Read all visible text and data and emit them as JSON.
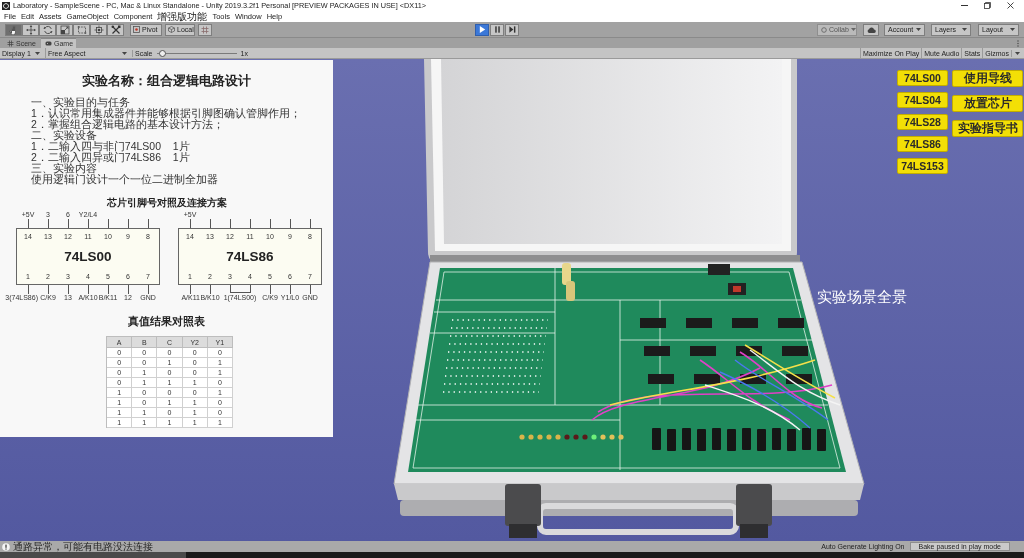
{
  "window": {
    "title": "Laboratory - SampleScene - PC, Mac & Linux Standalone - Unity 2019.3.2f1 Personal [PREVIEW PACKAGES IN USE] <DX11>"
  },
  "menu": [
    "File",
    "Edit",
    "Assets",
    "GameObject",
    "Component",
    "增强版功能",
    "Tools",
    "Window",
    "Help"
  ],
  "toolbar": {
    "tools": [
      {
        "kind": "hand",
        "selected": true
      },
      {
        "kind": "move",
        "selected": false
      },
      {
        "kind": "rotate",
        "selected": false
      },
      {
        "kind": "scale",
        "selected": false
      },
      {
        "kind": "rect",
        "selected": false
      },
      {
        "kind": "transform",
        "selected": false
      },
      {
        "kind": "custom",
        "selected": false
      }
    ],
    "pivot": "Pivot",
    "space": "Local",
    "play_controls": [
      {
        "kind": "play",
        "selected": true
      },
      {
        "kind": "pause",
        "selected": false
      },
      {
        "kind": "step",
        "selected": false
      }
    ],
    "collab": {
      "label": "Collab",
      "disabled": true
    },
    "account": "Account",
    "layers": "Layers",
    "layout": "Layout"
  },
  "tabs": [
    {
      "label": "Scene",
      "kind": "scene",
      "selected": false
    },
    {
      "label": "Game",
      "kind": "game",
      "selected": true
    }
  ],
  "game_toolbar": {
    "display": "Display 1",
    "aspect": "Free Aspect",
    "scale_label": "Scale",
    "scale_slider": {
      "level": 0.03
    },
    "scale_value": "1x",
    "toggles": [
      "Maximize On Play",
      "Mute Audio",
      "Stats"
    ],
    "gizmos": "Gizmos"
  },
  "guide_panel": {
    "title": "实验名称：组合逻辑电路设计",
    "lines": [
      "一、实验目的与任务",
      "1．认识常用集成器件并能够根据引脚图确认管脚作用；",
      "2．掌握组合逻辑电路的基本设计方法；",
      "二、实验设备",
      "1．二输入四与非门74LS00    1片",
      "2．二输入四异或门74LS86    1片",
      "三、实验内容",
      "使用逻辑门设计一个一位二进制全加器"
    ],
    "chips_heading": "芯片引脚号对照及连接方案",
    "chips": [
      {
        "name": "74LS00",
        "top_pins": [
          {
            "number": "14",
            "label": "+5V"
          },
          {
            "number": "13",
            "label": "3"
          },
          {
            "number": "12",
            "label": "6"
          },
          {
            "number": "11",
            "label": "Y2/L4"
          },
          {
            "number": "10"
          },
          {
            "number": "9"
          },
          {
            "number": "8"
          }
        ],
        "bottom_pins": [
          {
            "number": "1",
            "label": "3(74LS86)"
          },
          {
            "number": "2",
            "label": "C/K9"
          },
          {
            "number": "3",
            "label": "13"
          },
          {
            "number": "4",
            "label": "A/K10"
          },
          {
            "number": "5",
            "label": "B/K11"
          },
          {
            "number": "6",
            "label": "12"
          },
          {
            "number": "7",
            "label": "GND"
          }
        ]
      },
      {
        "name": "74LS86",
        "top_pins": [
          {
            "number": "14",
            "label": "+5V"
          },
          {
            "number": "13"
          },
          {
            "number": "12"
          },
          {
            "number": "11"
          },
          {
            "number": "10"
          },
          {
            "number": "9"
          },
          {
            "number": "8"
          }
        ],
        "bottom_pins": [
          {
            "number": "1",
            "label": "A/K11"
          },
          {
            "number": "2",
            "label": "B/K10"
          },
          {
            "number": "3",
            "label": "1(74LS00)",
            "bridged": true
          },
          {
            "number": "4"
          },
          {
            "number": "5",
            "label": "C/K9"
          },
          {
            "number": "6",
            "label": "Y1/L0"
          },
          {
            "number": "7",
            "label": "GND"
          }
        ]
      }
    ],
    "table_heading": "真值结果对照表",
    "table": {
      "columns": [
        "A",
        "B",
        "C",
        "Y2",
        "Y1"
      ],
      "rows": [
        [
          "0",
          "0",
          "0",
          "0",
          "0"
        ],
        [
          "0",
          "0",
          "1",
          "0",
          "1"
        ],
        [
          "0",
          "1",
          "0",
          "0",
          "1"
        ],
        [
          "0",
          "1",
          "1",
          "1",
          "0"
        ],
        [
          "1",
          "0",
          "0",
          "0",
          "1"
        ],
        [
          "1",
          "0",
          "1",
          "1",
          "0"
        ],
        [
          "1",
          "1",
          "0",
          "1",
          "0"
        ],
        [
          "1",
          "1",
          "1",
          "1",
          "1"
        ]
      ]
    }
  },
  "chip_buttons": [
    "74LS00",
    "74LS04",
    "74LS28",
    "74LS86",
    "74LS153"
  ],
  "action_buttons": [
    "使用导线",
    "放置芯片",
    "实验指导书"
  ],
  "scene_label": "实验场景全景",
  "status_bar": {
    "message": "通路异常，可能有电路没法连接",
    "lighting": "Auto Generate Lighting On",
    "bake": "Bake paused in play mode"
  }
}
